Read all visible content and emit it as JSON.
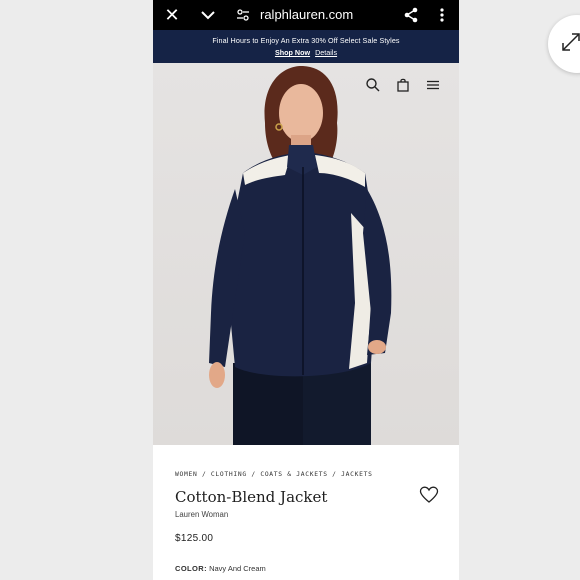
{
  "browser": {
    "url": "ralphlauren.com",
    "icons": [
      "close-icon",
      "chevron-down-icon",
      "site-settings-icon",
      "share-icon",
      "more-vert-icon"
    ]
  },
  "promo": {
    "line1": "Final Hours to Enjoy An Extra 30% Off Select Sale Styles",
    "shop_now": "Shop Now",
    "details": "Details"
  },
  "header_icons": [
    "search-icon",
    "bag-icon",
    "menu-icon"
  ],
  "product": {
    "breadcrumb": "WOMEN / CLOTHING / COATS & JACKETS / JACKETS",
    "title": "Cotton-Blend Jacket",
    "brand": "Lauren Woman",
    "price": "$125.00",
    "color_label": "COLOR:",
    "color_value": "Navy And Cream"
  },
  "colors": {
    "promo_bg": "#152346",
    "jacket_navy": "#1a2342",
    "cream": "#f2efe8"
  }
}
